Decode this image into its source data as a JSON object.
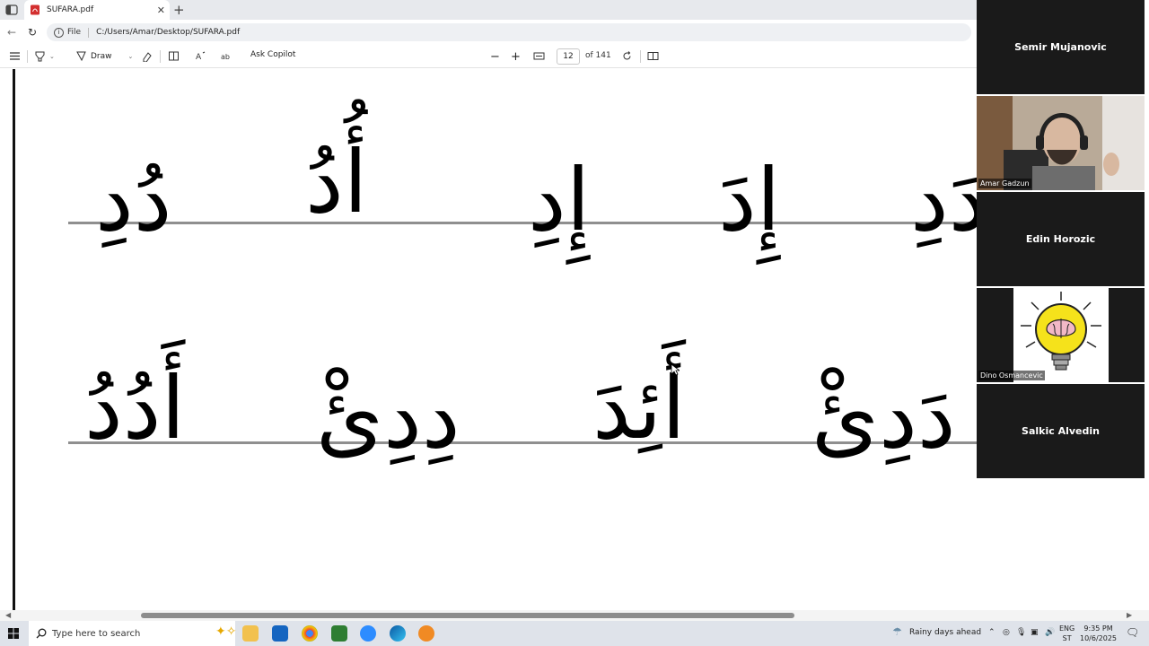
{
  "browser": {
    "tab_title": "SUFARA.pdf",
    "new_tab_symbol": "+",
    "url_scheme": "File",
    "url_path": "C:/Users/Amar/Desktop/SUFARA.pdf"
  },
  "toolbar": {
    "draw_label": "Draw",
    "ask_copilot_label": "Ask Copilot",
    "page_current": "12",
    "page_total": "of 141"
  },
  "document": {
    "row1": [
      "دُدِ",
      "أُدُ",
      "إِدِ",
      "إِدَ",
      "دَدِ"
    ],
    "row2": [
      "أَدُدُ",
      "دِدِئْ",
      "أَئِدَ",
      "دَدِئْ"
    ]
  },
  "participants": [
    {
      "name": "Semir Mujanovic"
    },
    {
      "name": "Amar Gadzun"
    },
    {
      "name": "Edin Horozic"
    },
    {
      "name": "Dino Osmancevic"
    },
    {
      "name": "Salkic Alvedin"
    }
  ],
  "taskbar": {
    "search_placeholder": "Type here to search",
    "weather": "Rainy days ahead",
    "lang_top": "ENG",
    "lang_bottom": "ST",
    "time": "9:35 PM",
    "date": "10/6/2025"
  },
  "colors": {
    "accent": "#d32f2f",
    "tile_bg": "#1a1a1a",
    "rule": "#8f8f8f"
  }
}
